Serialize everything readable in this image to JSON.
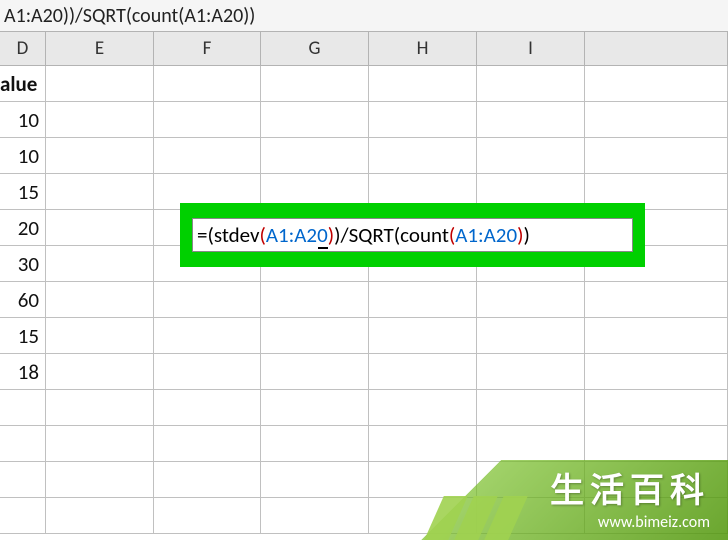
{
  "formula_bar": {
    "partial": "A1:A20))/SQRT(count(A1:A20))"
  },
  "columns": {
    "d": "D",
    "e": "E",
    "f": "F",
    "g": "G",
    "h": "H",
    "i": "I"
  },
  "rows": [
    {
      "d": "alue"
    },
    {
      "d": "10"
    },
    {
      "d": "10"
    },
    {
      "d": "15"
    },
    {
      "d": "20"
    },
    {
      "d": "30"
    },
    {
      "d": "60"
    },
    {
      "d": "15"
    },
    {
      "d": "18"
    },
    {
      "d": ""
    },
    {
      "d": ""
    },
    {
      "d": ""
    },
    {
      "d": ""
    }
  ],
  "formula_highlight": {
    "eq": "=",
    "p1o": "(",
    "fn1": "stdev",
    "p2o": "(",
    "ref1": "A1:A20",
    "p2c": ")",
    "p1c": ")",
    "div": "/SQRT",
    "p3o": "(",
    "fn2": "count",
    "p4o": "(",
    "ref2": "A1:A20",
    "p4c": ")",
    "p3c": ")"
  },
  "watermark": {
    "title": "生活百科",
    "url": "www.bimeiz.com"
  }
}
